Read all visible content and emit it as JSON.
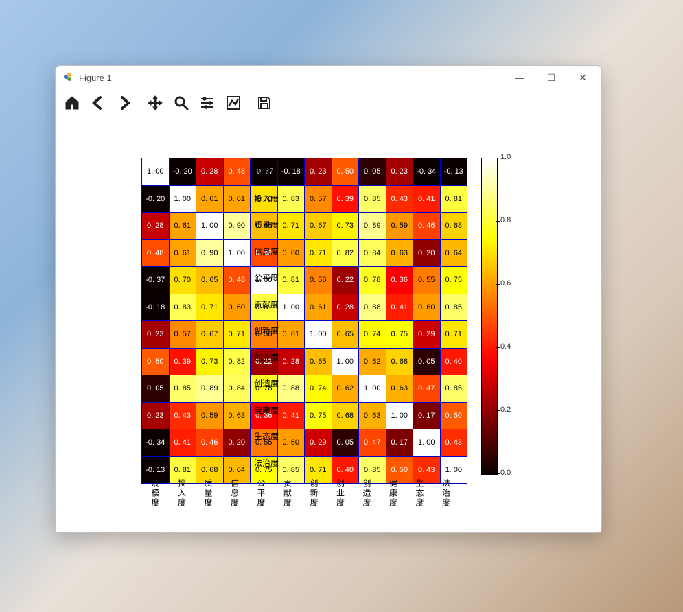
{
  "window": {
    "title": "Figure 1",
    "buttons": {
      "min": "—",
      "max": "☐",
      "close": "✕"
    }
  },
  "toolbar": {
    "home": "Home",
    "back": "Back",
    "forward": "Forward",
    "pan": "Pan",
    "zoom": "Zoom",
    "subplots": "Configure subplots",
    "axes": "Edit axis",
    "save": "Save"
  },
  "chart_data": {
    "type": "heatmap",
    "title": "",
    "categories": [
      "规模度",
      "投入度",
      "质量度",
      "信息度",
      "公平度",
      "贡献度",
      "创新度",
      "创业度",
      "创造度",
      "健康度",
      "生态度",
      "法治度"
    ],
    "matrix": [
      [
        1.0,
        -0.2,
        0.28,
        0.48,
        -0.37,
        -0.18,
        0.23,
        0.5,
        0.05,
        0.23,
        -0.34,
        -0.13
      ],
      [
        -0.2,
        1.0,
        0.61,
        0.61,
        0.7,
        0.83,
        0.57,
        0.39,
        0.85,
        0.43,
        0.41,
        0.81
      ],
      [
        0.28,
        0.61,
        1.0,
        0.9,
        0.65,
        0.71,
        0.67,
        0.73,
        0.89,
        0.59,
        0.46,
        0.68
      ],
      [
        0.48,
        0.61,
        0.9,
        1.0,
        0.48,
        0.6,
        0.71,
        0.82,
        0.84,
        0.63,
        0.2,
        0.64
      ],
      [
        -0.37,
        0.7,
        0.65,
        0.48,
        1.0,
        0.81,
        0.56,
        0.22,
        0.78,
        0.36,
        0.55,
        0.75
      ],
      [
        -0.18,
        0.83,
        0.71,
        0.6,
        0.81,
        1.0,
        0.61,
        0.28,
        0.88,
        0.41,
        0.6,
        0.85
      ],
      [
        0.23,
        0.57,
        0.67,
        0.71,
        0.56,
        0.61,
        1.0,
        0.65,
        0.74,
        0.75,
        0.29,
        0.71
      ],
      [
        0.5,
        0.39,
        0.73,
        0.82,
        0.22,
        0.28,
        0.65,
        1.0,
        0.62,
        0.68,
        0.05,
        0.4
      ],
      [
        0.05,
        0.85,
        0.89,
        0.84,
        0.78,
        0.88,
        0.74,
        0.62,
        1.0,
        0.63,
        0.47,
        0.85
      ],
      [
        0.23,
        0.43,
        0.59,
        0.63,
        0.36,
        0.41,
        0.75,
        0.68,
        0.63,
        1.0,
        0.17,
        0.5
      ],
      [
        -0.34,
        0.41,
        0.46,
        0.2,
        0.55,
        0.6,
        0.29,
        0.05,
        0.47,
        0.17,
        1.0,
        0.43
      ],
      [
        -0.13,
        0.81,
        0.68,
        0.64,
        0.75,
        0.85,
        0.71,
        0.4,
        0.85,
        0.5,
        0.43,
        1.0
      ]
    ],
    "clim": [
      0.0,
      1.0
    ],
    "cbar_ticks": [
      0.0,
      0.2,
      0.4,
      0.6,
      0.8,
      1.0
    ],
    "cmap": "hot"
  }
}
